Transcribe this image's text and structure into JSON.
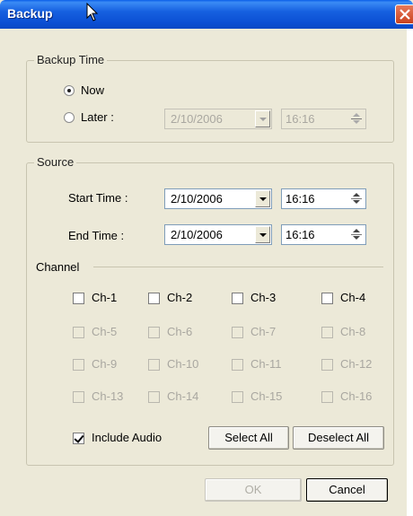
{
  "window": {
    "title": "Backup"
  },
  "backup_time": {
    "legend": "Backup Time",
    "now_label": "Now",
    "later_label": "Later :",
    "later_date": "2/10/2006",
    "later_time": "16:16"
  },
  "source": {
    "legend": "Source",
    "start_label": "Start Time :",
    "start_date": "2/10/2006",
    "start_time": "16:16",
    "end_label": "End Time :",
    "end_date": "2/10/2006",
    "end_time": "16:16"
  },
  "channel": {
    "legend": "Channel",
    "items": [
      "Ch-1",
      "Ch-2",
      "Ch-3",
      "Ch-4",
      "Ch-5",
      "Ch-6",
      "Ch-7",
      "Ch-8",
      "Ch-9",
      "Ch-10",
      "Ch-11",
      "Ch-12",
      "Ch-13",
      "Ch-14",
      "Ch-15",
      "Ch-16"
    ],
    "include_audio_label": "Include Audio",
    "select_all_label": "Select All",
    "deselect_all_label": "Deselect All"
  },
  "footer": {
    "ok_label": "OK",
    "cancel_label": "Cancel"
  }
}
